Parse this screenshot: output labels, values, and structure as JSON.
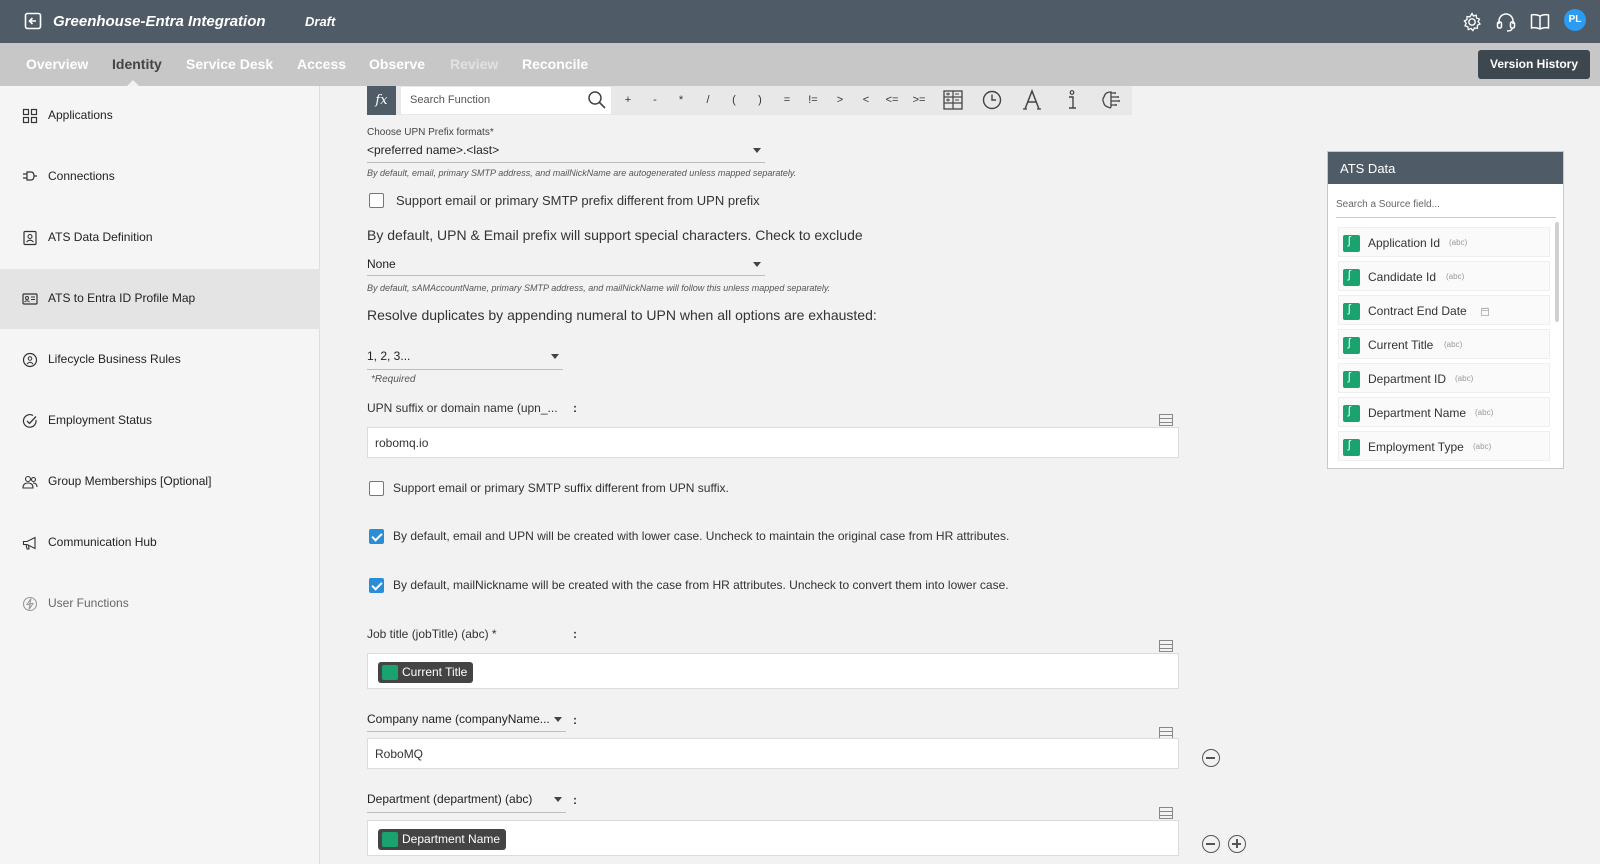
{
  "topbar": {
    "title": "Greenhouse-Entra Integration",
    "status": "Draft",
    "avatar_initials": "PL",
    "icons": [
      "back-icon",
      "gear-icon",
      "headset-icon",
      "book-icon"
    ]
  },
  "nav": {
    "tabs": [
      {
        "label": "Overview"
      },
      {
        "label": "Identity"
      },
      {
        "label": "Service Desk"
      },
      {
        "label": "Access"
      },
      {
        "label": "Observe"
      },
      {
        "label": "Review"
      },
      {
        "label": "Reconcile"
      }
    ],
    "active_tab": "Identity",
    "version_history": "Version History"
  },
  "sidebar": {
    "items": [
      {
        "label": "Applications",
        "icon": "grid-icon"
      },
      {
        "label": "Connections",
        "icon": "plug-icon"
      },
      {
        "label": "ATS Data Definition",
        "icon": "contact-card-icon"
      },
      {
        "label": "ATS to Entra ID Profile Map",
        "icon": "id-card-icon"
      },
      {
        "label": "Lifecycle Business Rules",
        "icon": "lifecycle-icon"
      },
      {
        "label": "Employment Status",
        "icon": "check-circle-icon"
      },
      {
        "label": "Group Memberships [Optional]",
        "icon": "group-icon"
      },
      {
        "label": "Communication Hub",
        "icon": "megaphone-icon"
      },
      {
        "label": "User Functions",
        "icon": "lightning-icon"
      }
    ],
    "active_item": "ATS to Entra ID Profile Map"
  },
  "function_bar": {
    "fx_label": "fx",
    "search_placeholder": "Search Function",
    "operators": [
      "+",
      "-",
      "*",
      "/",
      "(",
      ")",
      "=",
      "!=",
      ">",
      "<",
      "<=",
      ">="
    ]
  },
  "form": {
    "upn_prefix_label": "Choose UPN Prefix formats*",
    "upn_prefix_value": "<preferred name>.<last>",
    "upn_prefix_hint": "By default, email, primary SMTP address, and mailNickName are autogenerated unless mapped separately.",
    "support_prefix_label": "Support email or primary SMTP prefix different from UPN prefix",
    "support_prefix_checked": false,
    "special_chars_text": "By default, UPN & Email prefix will support special characters. Check to exclude",
    "special_chars_value": "None",
    "special_chars_hint": "By default, sAMAccountName, primary SMTP address, and mailNickName will follow this unless mapped separately.",
    "duplicates_text": "Resolve duplicates by appending numeral to UPN when all options are exhausted:",
    "duplicates_value": "1, 2, 3...",
    "duplicates_required": "*Required",
    "upn_suffix_label": "UPN suffix or domain name (upn_...",
    "upn_suffix_value": "robomq.io",
    "support_suffix_label": "Support email or primary SMTP suffix different from UPN suffix.",
    "support_suffix_checked": false,
    "lowercase_label": "By default, email and UPN will be created with lower case. Uncheck to maintain the original case from HR attributes.",
    "lowercase_checked": true,
    "mailnickname_label": "By default, mailNickname will be created with the case from HR attributes. Uncheck to convert them into lower case.",
    "mailnickname_checked": true,
    "job_title_label": "Job title (jobTitle) (abc) *",
    "job_title_chip": "Current Title",
    "company_label": "Company name (companyName...",
    "company_value": "RoboMQ",
    "department_label": "Department (department) (abc)",
    "department_chip": "Department Name",
    "colon": ":"
  },
  "ats_panel": {
    "title": "ATS Data",
    "search_placeholder": "Search a Source field...",
    "fields": [
      {
        "name": "Application Id",
        "type": "(abc)"
      },
      {
        "name": "Candidate Id",
        "type": "(abc)"
      },
      {
        "name": "Contract End Date",
        "type": "calendar-icon"
      },
      {
        "name": "Current Title",
        "type": "(abc)"
      },
      {
        "name": "Department ID",
        "type": "(abc)"
      },
      {
        "name": "Department Name",
        "type": "(abc)"
      },
      {
        "name": "Employment Type",
        "type": "(abc)"
      }
    ]
  },
  "colors": {
    "topbar": "#4f5b66",
    "navbar": "#c7c7c7",
    "accent_green": "#1aa36f",
    "checkbox_blue": "#2a8ed6",
    "avatar_blue": "#2b9cf2"
  }
}
